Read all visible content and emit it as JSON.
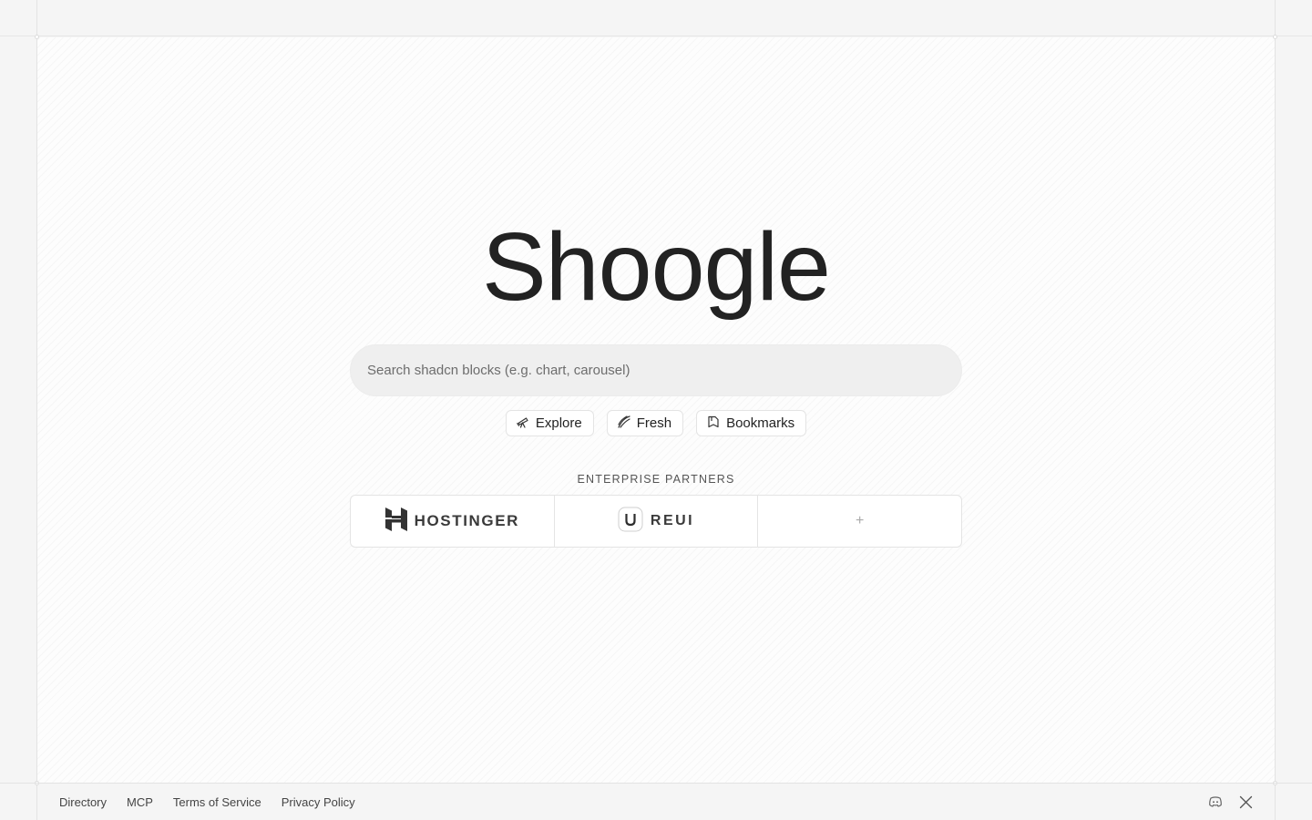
{
  "logo": {
    "text": "Shoogle"
  },
  "search": {
    "placeholder": "Search shadcn blocks (e.g. chart, carousel)",
    "value": ""
  },
  "chips": [
    {
      "label": "Explore",
      "icon": "telescope-icon"
    },
    {
      "label": "Fresh",
      "icon": "sparkle-icon"
    },
    {
      "label": "Bookmarks",
      "icon": "bookmark-icon"
    }
  ],
  "partners": {
    "title": "ENTERPRISE PARTNERS",
    "items": [
      {
        "name": "HOSTINGER",
        "icon": "hostinger-logo-icon"
      },
      {
        "name": "REUI",
        "icon": "reui-logo-icon"
      },
      {
        "name": "+",
        "icon": "plus-icon"
      }
    ]
  },
  "footer": {
    "links": [
      "Directory",
      "MCP",
      "Terms of Service",
      "Privacy Policy"
    ],
    "icons": [
      "discord-icon",
      "x-icon"
    ]
  },
  "colors": {
    "text": "#222222",
    "muted": "#6d6d6d",
    "border": "#e4e4e4",
    "background": "#f5f5f5"
  }
}
